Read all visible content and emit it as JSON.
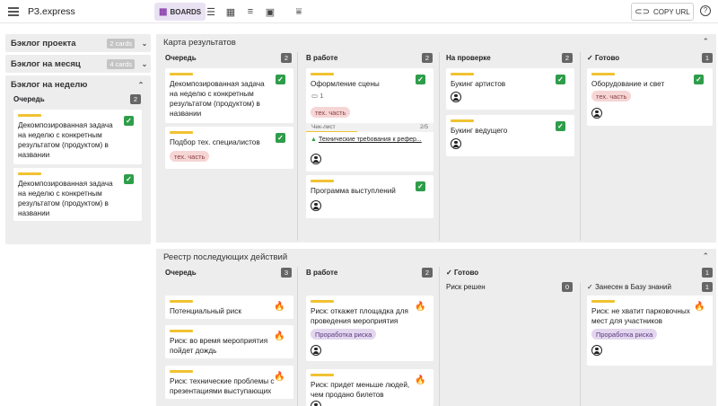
{
  "header": {
    "app_title": "РЗ.express",
    "boards_label": "BOARDS",
    "copy_url_label": "COPY URL"
  },
  "sidebar": {
    "blocks": [
      {
        "title": "Бэклог проекта",
        "badge": "2 cards"
      },
      {
        "title": "Бэклог на месяц",
        "badge": "4 cards"
      },
      {
        "title": "Бэклог на неделю",
        "badge": ""
      }
    ],
    "week_column": {
      "title": "Очередь",
      "count": "2",
      "cards": [
        {
          "text": "Декомпозированная задача на неделю с конкретным результатом (продуктом) в названии"
        },
        {
          "text": "Декомпозированная задача на неделю с конкретным результатом (продуктом) в названии"
        }
      ]
    }
  },
  "results": {
    "title": "Карта результатов",
    "columns": [
      {
        "title": "Очередь",
        "count": "2",
        "cards": [
          {
            "text": "Декомпозированная задача на неделю с конкретным результатом (продуктом) в названии"
          },
          {
            "text": "Подбор тех. специалистов",
            "tag": "тех. часть"
          }
        ]
      },
      {
        "title": "В работе",
        "count": "2",
        "cards": [
          {
            "text": "Оформление сцены",
            "comments": "1",
            "tag": "тех. часть",
            "checklist_label": "Чек-лист",
            "checklist_count": "2/5",
            "checklist_progress": 0.4,
            "doc": "Технические требования к рефер..."
          },
          {
            "text": "Программа выступлений"
          }
        ]
      },
      {
        "title": "На проверке",
        "count": "2",
        "cards": [
          {
            "text": "Букинг артистов"
          },
          {
            "text": "Букинг ведущего"
          }
        ]
      },
      {
        "title": "Готово",
        "count": "1",
        "cards": [
          {
            "text": "Оборудование и свет",
            "tag": "тех. часть"
          }
        ]
      }
    ]
  },
  "next_actions": {
    "title": "Реестр последующих действий",
    "columns": [
      {
        "title": "Очередь",
        "count": "3",
        "cards": [
          {
            "text": "Потенциальный риск"
          },
          {
            "text": "Риск: во время мероприятия пойдет дождь"
          },
          {
            "text": "Риск: технические проблемы с презентациями выступающих"
          }
        ]
      },
      {
        "title": "В работе",
        "count": "2",
        "cards": [
          {
            "text": "Риск: откажет площадка для проведения мероприятия",
            "tag": "Проработка риска"
          },
          {
            "text": "Риск: придет меньше людей, чем продано билетов"
          }
        ]
      },
      {
        "title": "Готово",
        "count": "1",
        "sub": {
          "title": "Риск решен",
          "count": "0"
        }
      },
      {
        "title": "Занесен в Базу знаний",
        "count": "1",
        "cards": [
          {
            "text": "Риск: не хватит парковочных мест для участников",
            "tag": "Проработка риска"
          }
        ]
      }
    ]
  },
  "colors": {
    "accent_bar": "#f1c232",
    "done_check": "#2e9d4a",
    "boards_active_bg": "#e9e2f3",
    "tag_red_bg": "#f6d5d5",
    "tag_purple_bg": "#e3d6ef",
    "risk_icon": "#e8542c"
  },
  "icons": [
    "menu-icon",
    "boards-icon",
    "list-view-icon",
    "table-view-icon",
    "timeline-view-icon",
    "calendar-view-icon",
    "filter-icon",
    "link-icon",
    "help-icon",
    "chevron-down-icon",
    "chevron-up-icon",
    "check-icon",
    "done-check-icon",
    "fire-icon",
    "avatar-icon",
    "comment-icon",
    "google-drive-icon"
  ]
}
